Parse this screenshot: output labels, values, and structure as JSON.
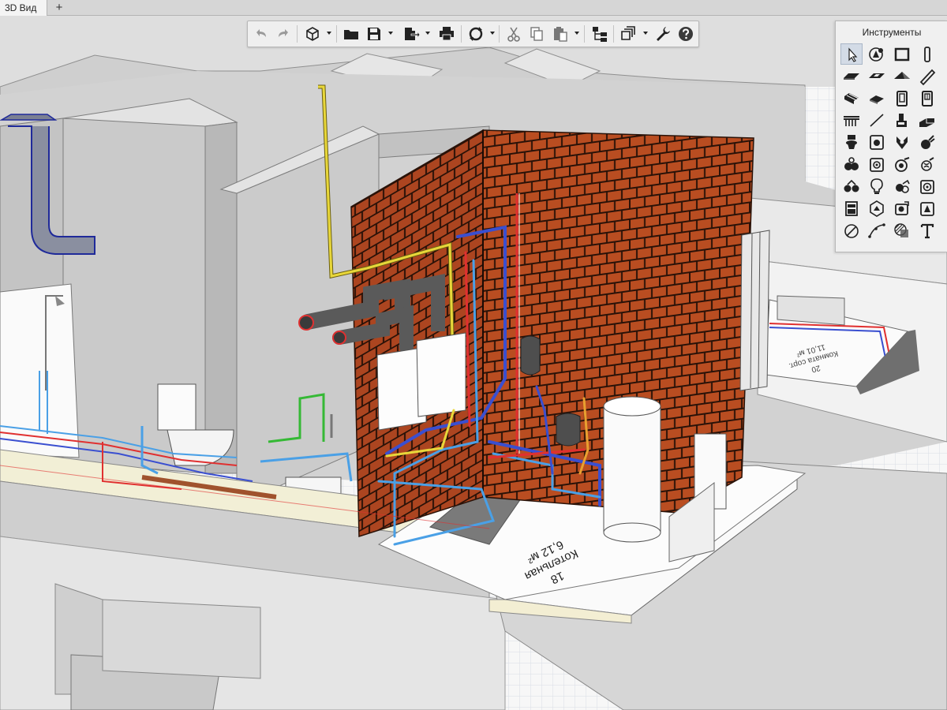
{
  "tab": {
    "title": "3D Вид",
    "add_label": "+"
  },
  "palette": {
    "title": "Инструменты",
    "tools": [
      {
        "icon": "select-arrow-icon"
      },
      {
        "icon": "object-tag-icon"
      },
      {
        "icon": "wall-icon"
      },
      {
        "icon": "column-icon"
      },
      {
        "icon": "slab-icon"
      },
      {
        "icon": "floor-opening-icon"
      },
      {
        "icon": "roof-icon"
      },
      {
        "icon": "beam-icon"
      },
      {
        "icon": "stair-icon"
      },
      {
        "icon": "foundation-icon"
      },
      {
        "icon": "door-icon"
      },
      {
        "icon": "window-icon"
      },
      {
        "icon": "railing-icon"
      },
      {
        "icon": "line-icon"
      },
      {
        "icon": "equipment-icon"
      },
      {
        "icon": "duct-icon"
      },
      {
        "icon": "toilet-icon"
      },
      {
        "icon": "sink-icon"
      },
      {
        "icon": "radiator-icon"
      },
      {
        "icon": "valve-icon"
      },
      {
        "icon": "pipe-fitting-icon"
      },
      {
        "icon": "pump-icon"
      },
      {
        "icon": "air-terminal-icon"
      },
      {
        "icon": "cable-icon"
      },
      {
        "icon": "pipe-network-icon"
      },
      {
        "icon": "lighting-icon"
      },
      {
        "icon": "sprinkler-icon"
      },
      {
        "icon": "outlet-icon"
      },
      {
        "icon": "panel-icon"
      },
      {
        "icon": "object-3d-icon"
      },
      {
        "icon": "camera-icon"
      },
      {
        "icon": "fire-detector-icon"
      },
      {
        "icon": "dimension-icon"
      },
      {
        "icon": "polyline-icon"
      },
      {
        "icon": "hatch-icon"
      },
      {
        "icon": "text-icon"
      }
    ]
  },
  "scene": {
    "room_boiler": {
      "number": "18",
      "name": "Котельная",
      "area": "6,12 м²"
    },
    "room_right": {
      "number": "20",
      "name": "Комната сорт.",
      "area": "11,01 м²"
    }
  },
  "colors": {
    "brick": "#b94d21",
    "mortar": "#2a1208",
    "hot_water": "#e03030",
    "cold_water": "#4aa0e6",
    "heating": "#3a4fd0",
    "gas": "#e8d73a",
    "green_pipe": "#35b935",
    "wall_grey": "#c7c7c7"
  }
}
